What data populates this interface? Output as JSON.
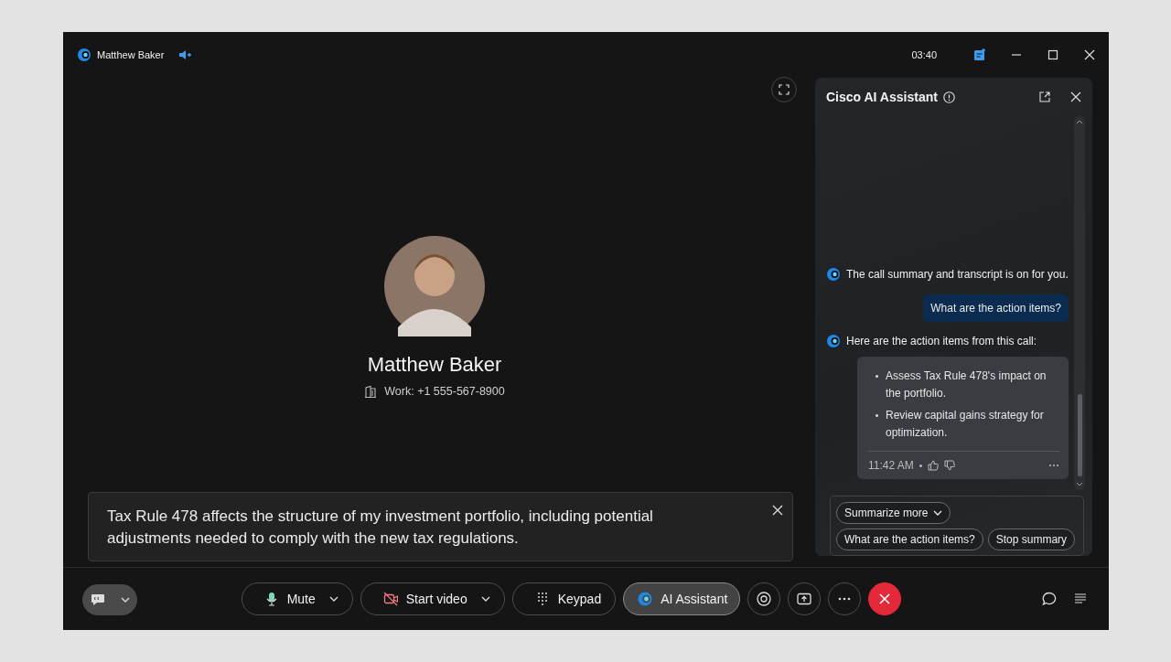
{
  "window": {
    "title": "Matthew Baker",
    "time": "03:40"
  },
  "contact": {
    "name": "Matthew Baker",
    "phone": "Work: +1 555-567-8900"
  },
  "caption": {
    "text": "Tax Rule 478 affects the structure of my investment portfolio, including potential adjustments needed to comply with the new tax regulations."
  },
  "assistant": {
    "title": "Cisco AI Assistant",
    "messages": [
      {
        "kind": "bot",
        "text": "The call summary and transcript is on for you."
      },
      {
        "kind": "user",
        "text": "What are the action items?"
      },
      {
        "kind": "bot",
        "text": "Here are the action items from this call:",
        "card": {
          "items": [
            "Assess Tax Rule 478's impact on the portfolio.",
            "Review capital gains strategy for optimization."
          ],
          "time": "11:42 AM"
        }
      }
    ],
    "suggestions": [
      {
        "label": "Summarize more",
        "dropdown": true
      },
      {
        "label": "What are the action items?",
        "dropdown": false
      },
      {
        "label": "Stop summary",
        "dropdown": false
      }
    ]
  },
  "toolbar": [
    {
      "kind": "mute",
      "label": "Mute",
      "dropdown": true,
      "active": false
    },
    {
      "kind": "video",
      "label": "Start video",
      "dropdown": true,
      "active": false
    },
    {
      "kind": "keypad",
      "label": "Keypad",
      "dropdown": false,
      "active": false
    },
    {
      "kind": "assistant",
      "label": "AI Assistant",
      "dropdown": false,
      "active": true
    },
    {
      "kind": "record",
      "active": false
    },
    {
      "kind": "share",
      "active": false
    },
    {
      "kind": "more",
      "active": false
    },
    {
      "kind": "end",
      "active": false
    }
  ]
}
